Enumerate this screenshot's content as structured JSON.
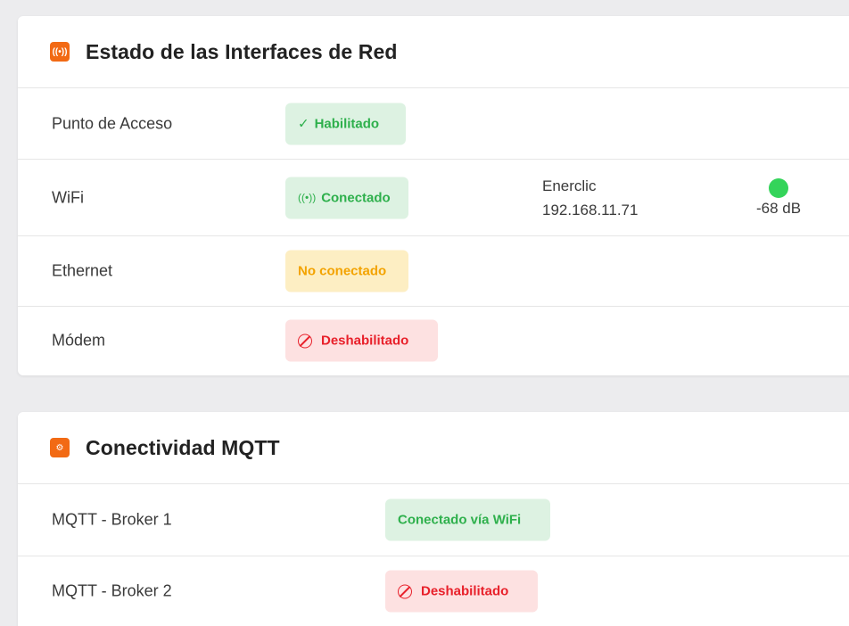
{
  "network": {
    "title": "Estado de las Interfaces de Red",
    "icon": "broadcast-icon",
    "accent": "#f26a14",
    "rows": [
      {
        "label": "Punto de Acceso",
        "status": "Habilitado",
        "status_icon": "✓",
        "status_color": "green"
      },
      {
        "label": "WiFi",
        "status": "Conectado",
        "status_icon": "((•))",
        "status_color": "green",
        "ssid": "Enerclic",
        "ip": "192.168.11.71",
        "signal": "-68 dB",
        "signal_color": "#34d45a"
      },
      {
        "label": "Ethernet",
        "status": "No conectado",
        "status_color": "yellow"
      },
      {
        "label": "Módem",
        "status": "Deshabilitado",
        "status_icon": "ban",
        "status_color": "red"
      }
    ]
  },
  "mqtt": {
    "title": "Conectividad MQTT",
    "icon": "gears-icon",
    "rows": [
      {
        "label": "MQTT - Broker 1",
        "status": "Conectado vía WiFi",
        "status_color": "green"
      },
      {
        "label": "MQTT - Broker 2",
        "status": "Deshabilitado",
        "status_icon": "ban",
        "status_color": "red"
      }
    ]
  }
}
